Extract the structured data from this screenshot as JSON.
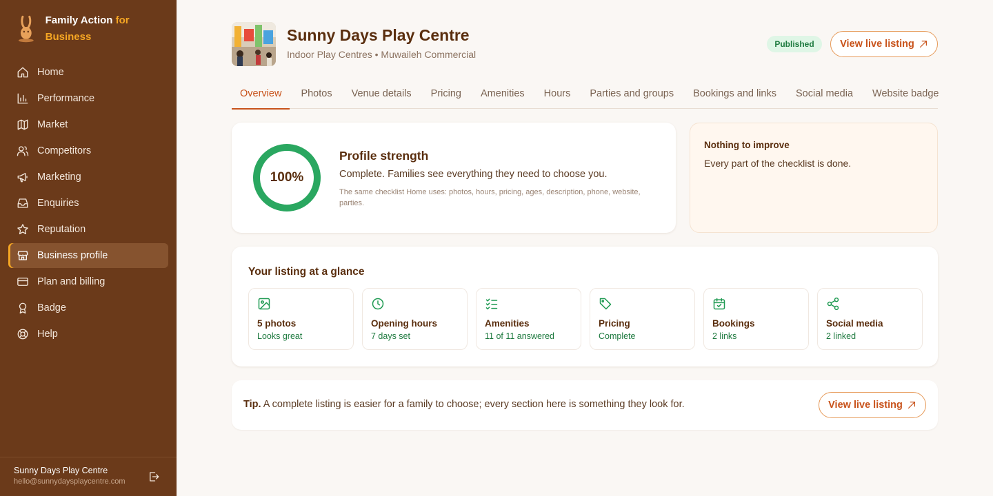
{
  "brand": {
    "name": "Family Action",
    "suffix": "for Business"
  },
  "nav": [
    {
      "label": "Home",
      "icon": "home-icon"
    },
    {
      "label": "Performance",
      "icon": "bar-chart-icon"
    },
    {
      "label": "Market",
      "icon": "map-icon"
    },
    {
      "label": "Competitors",
      "icon": "users-icon"
    },
    {
      "label": "Marketing",
      "icon": "megaphone-icon"
    },
    {
      "label": "Enquiries",
      "icon": "inbox-icon"
    },
    {
      "label": "Reputation",
      "icon": "star-icon"
    },
    {
      "label": "Business profile",
      "icon": "store-icon",
      "active": true
    },
    {
      "label": "Plan and billing",
      "icon": "credit-card-icon"
    },
    {
      "label": "Badge",
      "icon": "award-icon"
    },
    {
      "label": "Help",
      "icon": "lifebuoy-icon"
    }
  ],
  "account": {
    "name": "Sunny Days Play Centre",
    "email": "hello@sunnydaysplaycentre.com"
  },
  "header": {
    "title": "Sunny Days Play Centre",
    "subtitle": "Indoor Play Centres • Muwaileh Commercial",
    "status": "Published",
    "view_button": "View live listing"
  },
  "tabs": [
    "Overview",
    "Photos",
    "Venue details",
    "Pricing",
    "Amenities",
    "Hours",
    "Parties and groups",
    "Bookings and links",
    "Social media",
    "Website badge"
  ],
  "active_tab": "Overview",
  "strength": {
    "percent": 100,
    "percent_label": "100%",
    "title": "Profile strength",
    "description": "Complete. Families see everything they need to choose you.",
    "note": "The same checklist Home uses: photos, hours, pricing, ages, description, phone, website, parties."
  },
  "improve": {
    "title": "Nothing to improve",
    "description": "Every part of the checklist is done."
  },
  "glance": {
    "title": "Your listing at a glance",
    "items": [
      {
        "icon": "image-icon",
        "label": "5 photos",
        "value": "Looks great"
      },
      {
        "icon": "clock-icon",
        "label": "Opening hours",
        "value": "7 days set"
      },
      {
        "icon": "checklist-icon",
        "label": "Amenities",
        "value": "11 of 11 answered"
      },
      {
        "icon": "tag-icon",
        "label": "Pricing",
        "value": "Complete"
      },
      {
        "icon": "calendar-check-icon",
        "label": "Bookings",
        "value": "2 links"
      },
      {
        "icon": "share-icon",
        "label": "Social media",
        "value": "2 linked"
      }
    ]
  },
  "tip": {
    "lead": "Tip.",
    "text": "A complete listing is easier for a family to choose; every section here is something they look for.",
    "button": "View live listing"
  },
  "colors": {
    "sidebar": "#6b3a1a",
    "accent": "#c8521a",
    "brand_accent": "#f5a623",
    "success": "#1f9a52"
  }
}
